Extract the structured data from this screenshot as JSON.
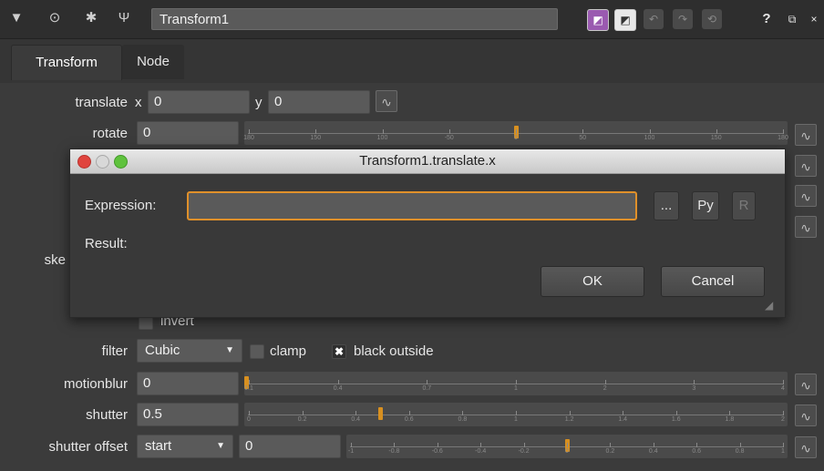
{
  "header": {
    "node_name": "Transform1",
    "help": "?",
    "icons": [
      "triangle-down-icon",
      "viewer-icon",
      "bug-icon",
      "tool-icon",
      "purple-swatch-icon",
      "white-swatch-icon",
      "undo-icon",
      "redo-icon",
      "revert-icon",
      "help-icon",
      "float-icon",
      "close-icon"
    ]
  },
  "tabs": [
    {
      "label": "Transform"
    },
    {
      "label": "Node"
    }
  ],
  "params": {
    "translate": {
      "label": "translate",
      "x_label": "x",
      "x": "0",
      "y_label": "y",
      "y": "0"
    },
    "rotate": {
      "label": "rotate",
      "value": "0",
      "ticks": [
        "180",
        "150",
        "100",
        "-50",
        "0",
        "50",
        "100",
        "150",
        "180"
      ]
    },
    "skew_label": "ske",
    "invert": {
      "label": "invert"
    },
    "filter": {
      "label": "filter",
      "value": "Cubic",
      "clamp": "clamp",
      "black_outside": "black outside"
    },
    "motionblur": {
      "label": "motionblur",
      "value": "0",
      "ticks": [
        "0.1",
        "0.4",
        "0.7",
        "1",
        "2",
        "3",
        "4"
      ]
    },
    "shutter": {
      "label": "shutter",
      "value": "0.5",
      "ticks": [
        "0",
        "0.2",
        "0.4",
        "0.6",
        "0.8",
        "1",
        "1.2",
        "1.4",
        "1.6",
        "1.8",
        "2"
      ]
    },
    "shutter_offset": {
      "label": "shutter offset",
      "mode": "start",
      "value": "0",
      "ticks": [
        "-1",
        "-0.8",
        "-0.6",
        "-0.4",
        "-0.2",
        "0",
        "0.2",
        "0.4",
        "0.6",
        "0.8",
        "1"
      ]
    }
  },
  "dialog": {
    "title": "Transform1.translate.x",
    "expression_label": "Expression:",
    "expression_value": "",
    "ellipsis_label": "...",
    "py_label": "Py",
    "r_label": "R",
    "result_label": "Result:",
    "ok_label": "OK",
    "cancel_label": "Cancel"
  },
  "colors": {
    "accent": "#e0902a",
    "slider_handle": "#d89020",
    "panel": "#3b3b3b"
  }
}
